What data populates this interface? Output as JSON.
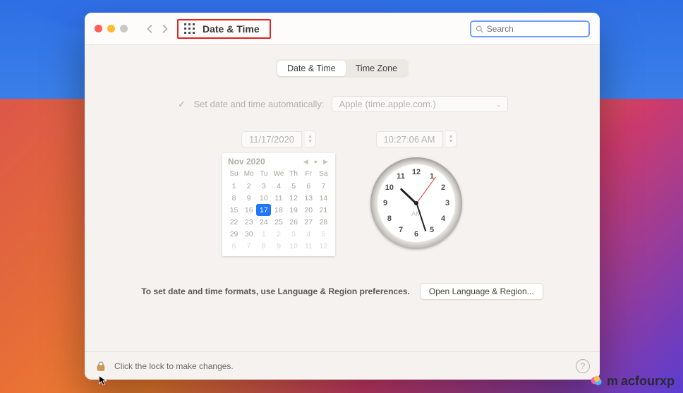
{
  "toolbar": {
    "title": "Date & Time",
    "search_placeholder": "Search"
  },
  "tabs": {
    "datetime": "Date & Time",
    "timezone": "Time Zone"
  },
  "auto": {
    "label": "Set date and time automatically:",
    "server": "Apple (time.apple.com.)"
  },
  "date_field": "11/17/2020",
  "time_field": "10:27:06 AM",
  "calendar": {
    "month_label": "Nov 2020",
    "weekdays": [
      "Su",
      "Mo",
      "Tu",
      "We",
      "Th",
      "Fr",
      "Sa"
    ],
    "rows": [
      [
        {
          "d": "1"
        },
        {
          "d": "2"
        },
        {
          "d": "3"
        },
        {
          "d": "4"
        },
        {
          "d": "5"
        },
        {
          "d": "6"
        },
        {
          "d": "7"
        }
      ],
      [
        {
          "d": "8"
        },
        {
          "d": "9"
        },
        {
          "d": "10"
        },
        {
          "d": "11"
        },
        {
          "d": "12"
        },
        {
          "d": "13"
        },
        {
          "d": "14"
        }
      ],
      [
        {
          "d": "15"
        },
        {
          "d": "16"
        },
        {
          "d": "17",
          "sel": true
        },
        {
          "d": "18"
        },
        {
          "d": "19"
        },
        {
          "d": "20"
        },
        {
          "d": "21"
        }
      ],
      [
        {
          "d": "22"
        },
        {
          "d": "23"
        },
        {
          "d": "24"
        },
        {
          "d": "25"
        },
        {
          "d": "26"
        },
        {
          "d": "27"
        },
        {
          "d": "28"
        }
      ],
      [
        {
          "d": "29"
        },
        {
          "d": "30"
        },
        {
          "d": "1",
          "dim": true
        },
        {
          "d": "2",
          "dim": true
        },
        {
          "d": "3",
          "dim": true
        },
        {
          "d": "4",
          "dim": true
        },
        {
          "d": "5",
          "dim": true
        }
      ],
      [
        {
          "d": "6",
          "dim": true
        },
        {
          "d": "7",
          "dim": true
        },
        {
          "d": "8",
          "dim": true
        },
        {
          "d": "9",
          "dim": true
        },
        {
          "d": "10",
          "dim": true
        },
        {
          "d": "11",
          "dim": true
        },
        {
          "d": "12",
          "dim": true
        }
      ]
    ]
  },
  "clock": {
    "hour": 10,
    "minute": 27,
    "second": 6,
    "ampm": "AM",
    "numerals": [
      "12",
      "1",
      "2",
      "3",
      "4",
      "5",
      "6",
      "7",
      "8",
      "9",
      "10",
      "11"
    ]
  },
  "footer_note": "To set date and time formats, use Language & Region preferences.",
  "open_lang_region": "Open Language & Region...",
  "lock_msg": "Click the lock to make changes.",
  "brand": "acfourxp"
}
